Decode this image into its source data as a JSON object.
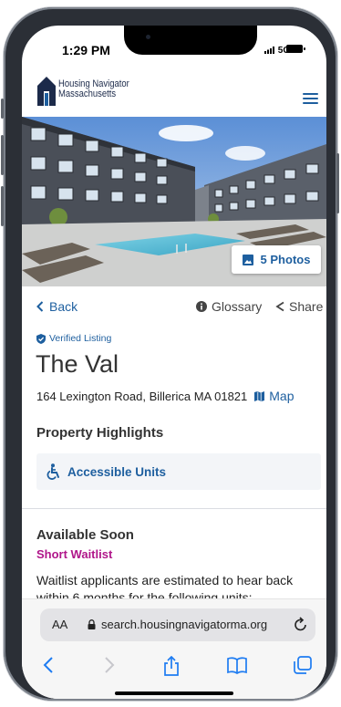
{
  "status": {
    "time": "1:29 PM",
    "network": "5G"
  },
  "site": {
    "logo_line1": "Housing Navigator",
    "logo_line2": "Massachusetts",
    "menu_icon": "hamburger-icon"
  },
  "hero": {
    "photos_label": "5 Photos",
    "photos_icon": "image-icon"
  },
  "nav": {
    "back": "Back",
    "glossary": "Glossary",
    "share": "Share"
  },
  "listing": {
    "verified": "Verified Listing",
    "title": "The Val",
    "address": "164 Lexington Road, Billerica MA 01821",
    "map_label": "Map"
  },
  "highlights": {
    "heading": "Property Highlights",
    "items": [
      {
        "label": "Accessible Units",
        "icon": "wheelchair-icon"
      }
    ]
  },
  "availability": {
    "heading": "Available Soon",
    "status": "Short Waitlist",
    "description": "Waitlist applicants are estimated to hear back within 6 months for the following units:"
  },
  "browser": {
    "aa": "AA",
    "url": "search.housingnavigatorma.org",
    "toolbar_icons": [
      "back-icon",
      "forward-icon",
      "share-icon",
      "bookmarks-icon",
      "tabs-icon"
    ]
  },
  "colors": {
    "brand_blue": "#1e5f9f",
    "logo_navy": "#1c2a4a",
    "waitlist": "#b0168a"
  }
}
